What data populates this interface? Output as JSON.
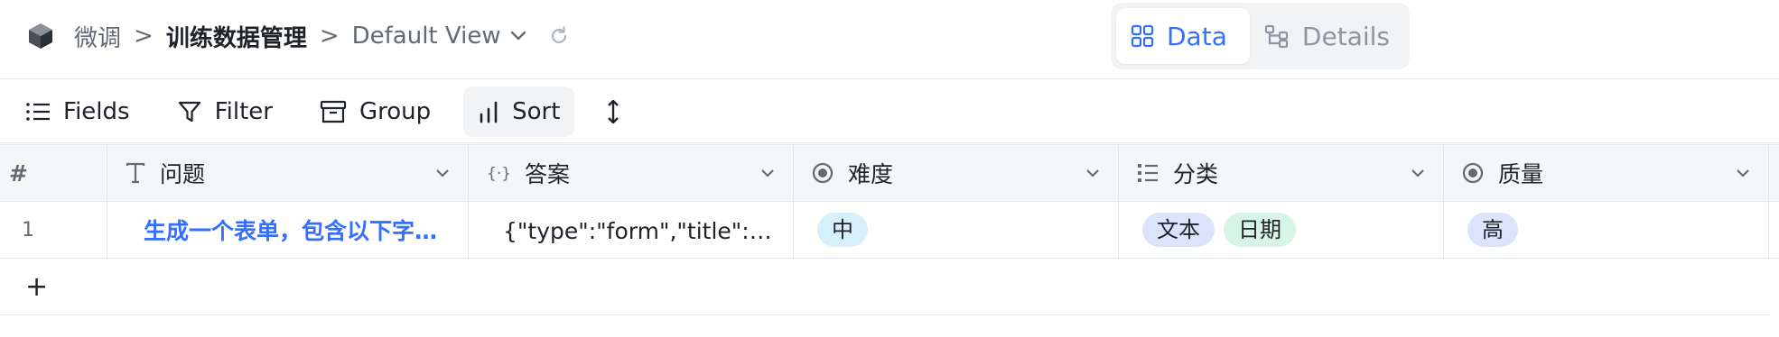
{
  "breadcrumb": {
    "app": "微调",
    "sep1": ">",
    "section": "训练数据管理",
    "sep2": ">",
    "view": "Default View"
  },
  "view_toggle": {
    "data_label": "Data",
    "details_label": "Details"
  },
  "toolbar": {
    "fields": "Fields",
    "filter": "Filter",
    "group": "Group",
    "sort": "Sort"
  },
  "table": {
    "row_number_header": "#",
    "columns": [
      {
        "label": "问题",
        "icon": "text-type-icon"
      },
      {
        "label": "答案",
        "icon": "json-icon"
      },
      {
        "label": "难度",
        "icon": "single-select-icon"
      },
      {
        "label": "分类",
        "icon": "multi-select-icon"
      },
      {
        "label": "质量",
        "icon": "single-select-icon"
      }
    ],
    "rows": [
      {
        "index": "1",
        "question": "生成一个表单，包含以下字…",
        "answer": "{\"type\":\"form\",\"title\":\"表…",
        "difficulty": "中",
        "categories": [
          "文本",
          "日期"
        ],
        "quality": "高"
      }
    ],
    "add_row": "+"
  },
  "colors": {
    "accent": "#3370ff",
    "tag_difficulty": "#d6f0fb",
    "tag_text": "#dbe4fb",
    "tag_date": "#d7f5e6",
    "tag_quality": "#dbe4fb"
  }
}
